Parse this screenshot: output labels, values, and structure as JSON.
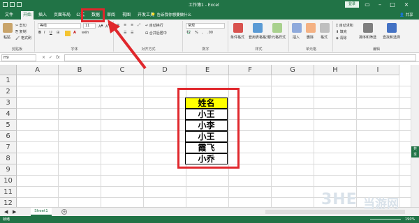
{
  "window": {
    "title": "工作簿1 - Excel",
    "login_label": "登录"
  },
  "tabs": [
    {
      "label": "文件"
    },
    {
      "label": "开始"
    },
    {
      "label": "插入"
    },
    {
      "label": "页面布局"
    },
    {
      "label": "公式"
    },
    {
      "label": "数据"
    },
    {
      "label": "审阅"
    },
    {
      "label": "视图"
    },
    {
      "label": "开发工具"
    }
  ],
  "tell_me": "告诉我你想要做什么",
  "share_label": "共享",
  "ribbon": {
    "clipboard": {
      "label": "剪贴板",
      "paste": "粘贴",
      "cut": "剪切",
      "copy": "复制",
      "format_painter": "格式刷"
    },
    "font": {
      "label": "字体",
      "font_name": "等线",
      "font_size": "11",
      "wen": "wén"
    },
    "alignment": {
      "label": "对齐方式",
      "wrap": "自动换行",
      "merge": "合并后居中"
    },
    "number": {
      "label": "数字",
      "format": "常规"
    },
    "styles": {
      "label": "样式",
      "conditional": "条件格式",
      "table": "套用表格格式",
      "cell_styles": "单元格样式"
    },
    "cells": {
      "label": "单元格",
      "insert": "插入",
      "delete": "删除",
      "format": "格式"
    },
    "editing": {
      "label": "编辑",
      "autosum": "自动求和",
      "fill": "填充",
      "clear": "清除",
      "sort": "排序和筛选",
      "find": "查找和选择"
    }
  },
  "formula_bar": {
    "name_box": "H9",
    "fx": "fx",
    "cancel": "×",
    "confirm": "✓"
  },
  "grid": {
    "columns": [
      "A",
      "B",
      "C",
      "D",
      "E",
      "F",
      "G",
      "H",
      "I"
    ],
    "rows": [
      "1",
      "2",
      "3",
      "4",
      "5",
      "6",
      "7",
      "8",
      "9",
      "10",
      "11",
      "12"
    ]
  },
  "table": {
    "header": "姓名",
    "names": [
      "小王",
      "小李",
      "小王",
      "霞飞",
      "小乔"
    ],
    "header_color": "#ffff00"
  },
  "sheet_tab": "Sheet1",
  "status": {
    "ready": "就绪",
    "zoom": "190%"
  },
  "watermark": {
    "logo": "3HE",
    "text": "当游网"
  },
  "colors": {
    "excel_green": "#217346",
    "highlight_red": "#e0272c"
  }
}
